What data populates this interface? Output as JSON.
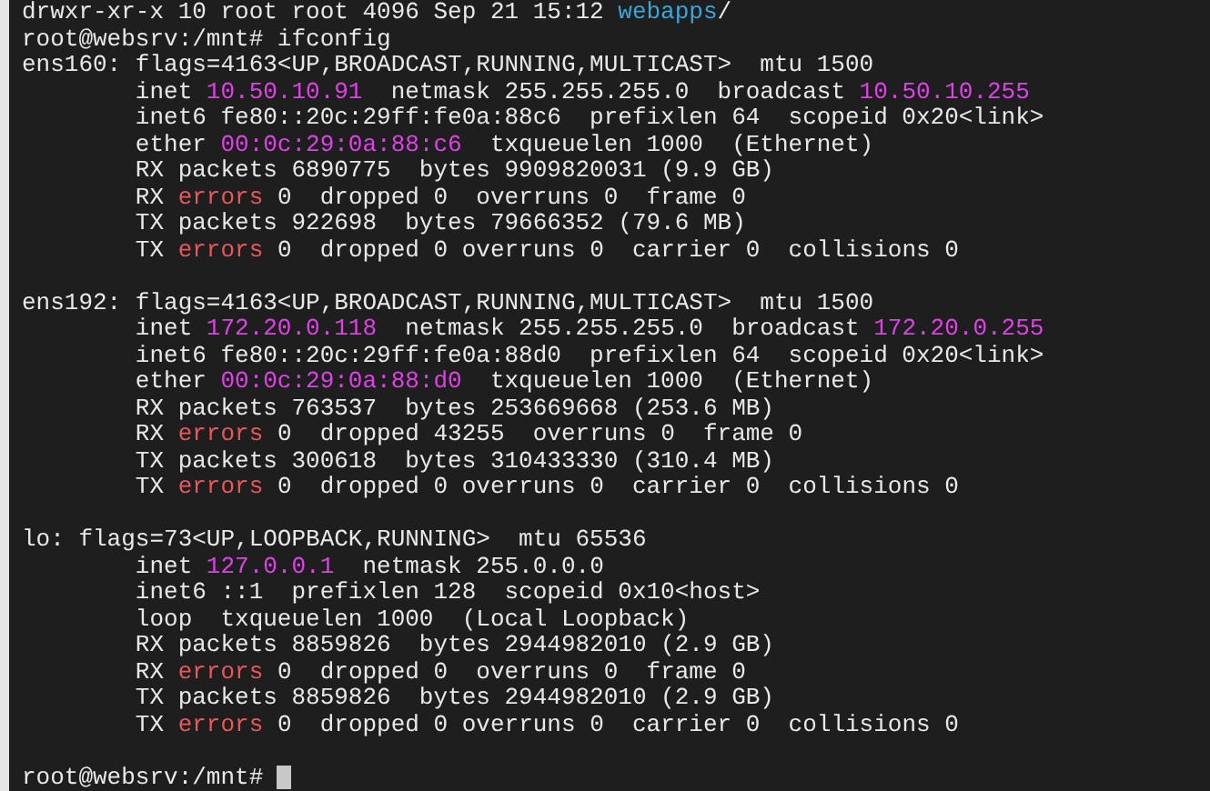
{
  "terminal": {
    "blocks": [
      {
        "lines": [
          {
            "segments": [
              {
                "text": "drwxr-xr-x 10 root root 4096 Sep 21 15:12 ",
                "kind": "plain"
              },
              {
                "text": "webapps",
                "kind": "dir"
              },
              {
                "text": "/",
                "kind": "plain"
              }
            ]
          },
          {
            "segments": [
              {
                "text": "root@websrv:/mnt# ifconfig",
                "kind": "plain"
              }
            ]
          },
          {
            "segments": [
              {
                "text": "ens160: flags=4163<UP,BROADCAST,RUNNING,MULTICAST>  mtu 1500",
                "kind": "plain"
              }
            ]
          },
          {
            "segments": [
              {
                "text": "        inet ",
                "kind": "plain"
              },
              {
                "text": "10.50.10.91",
                "kind": "address"
              },
              {
                "text": "  netmask 255.255.255.0  broadcast ",
                "kind": "plain"
              },
              {
                "text": "10.50.10.255",
                "kind": "address"
              }
            ]
          },
          {
            "segments": [
              {
                "text": "        inet6 fe80::20c:29ff:fe0a:88c6  prefixlen 64  scopeid 0x20<link>",
                "kind": "plain"
              }
            ]
          },
          {
            "segments": [
              {
                "text": "        ether ",
                "kind": "plain"
              },
              {
                "text": "00:0c:29:0a:88:c6",
                "kind": "address"
              },
              {
                "text": "  txqueuelen 1000  (Ethernet)",
                "kind": "plain"
              }
            ]
          },
          {
            "segments": [
              {
                "text": "        RX packets 6890775  bytes 9909820031 (9.9 GB)",
                "kind": "plain"
              }
            ]
          },
          {
            "segments": [
              {
                "text": "        RX ",
                "kind": "plain"
              },
              {
                "text": "errors",
                "kind": "error"
              },
              {
                "text": " 0  dropped 0  overruns 0  frame 0",
                "kind": "plain"
              }
            ]
          },
          {
            "segments": [
              {
                "text": "        TX packets 922698  bytes 79666352 (79.6 MB)",
                "kind": "plain"
              }
            ]
          },
          {
            "segments": [
              {
                "text": "        TX ",
                "kind": "plain"
              },
              {
                "text": "errors",
                "kind": "error"
              },
              {
                "text": " 0  dropped 0 overruns 0  carrier 0  collisions 0",
                "kind": "plain"
              }
            ]
          }
        ]
      },
      {
        "lines": [
          {
            "segments": [
              {
                "text": "ens192: flags=4163<UP,BROADCAST,RUNNING,MULTICAST>  mtu 1500",
                "kind": "plain"
              }
            ]
          },
          {
            "segments": [
              {
                "text": "        inet ",
                "kind": "plain"
              },
              {
                "text": "172.20.0.118",
                "kind": "address"
              },
              {
                "text": "  netmask 255.255.255.0  broadcast ",
                "kind": "plain"
              },
              {
                "text": "172.20.0.255",
                "kind": "address"
              }
            ]
          },
          {
            "segments": [
              {
                "text": "        inet6 fe80::20c:29ff:fe0a:88d0  prefixlen 64  scopeid 0x20<link>",
                "kind": "plain"
              }
            ]
          },
          {
            "segments": [
              {
                "text": "        ether ",
                "kind": "plain"
              },
              {
                "text": "00:0c:29:0a:88:d0",
                "kind": "address"
              },
              {
                "text": "  txqueuelen 1000  (Ethernet)",
                "kind": "plain"
              }
            ]
          },
          {
            "segments": [
              {
                "text": "        RX packets 763537  bytes 253669668 (253.6 MB)",
                "kind": "plain"
              }
            ]
          },
          {
            "segments": [
              {
                "text": "        RX ",
                "kind": "plain"
              },
              {
                "text": "errors",
                "kind": "error"
              },
              {
                "text": " 0  dropped 43255  overruns 0  frame 0",
                "kind": "plain"
              }
            ]
          },
          {
            "segments": [
              {
                "text": "        TX packets 300618  bytes 310433330 (310.4 MB)",
                "kind": "plain"
              }
            ]
          },
          {
            "segments": [
              {
                "text": "        TX ",
                "kind": "plain"
              },
              {
                "text": "errors",
                "kind": "error"
              },
              {
                "text": " 0  dropped 0 overruns 0  carrier 0  collisions 0",
                "kind": "plain"
              }
            ]
          }
        ]
      },
      {
        "lines": [
          {
            "segments": [
              {
                "text": "lo: flags=73<UP,LOOPBACK,RUNNING>  mtu 65536",
                "kind": "plain"
              }
            ]
          },
          {
            "segments": [
              {
                "text": "        inet ",
                "kind": "plain"
              },
              {
                "text": "127.0.0.1",
                "kind": "address"
              },
              {
                "text": "  netmask 255.0.0.0",
                "kind": "plain"
              }
            ]
          },
          {
            "segments": [
              {
                "text": "        inet6 ::1  prefixlen 128  scopeid 0x10<host>",
                "kind": "plain"
              }
            ]
          },
          {
            "segments": [
              {
                "text": "        loop  txqueuelen 1000  (Local Loopback)",
                "kind": "plain"
              }
            ]
          },
          {
            "segments": [
              {
                "text": "        RX packets 8859826  bytes 2944982010 (2.9 GB)",
                "kind": "plain"
              }
            ]
          },
          {
            "segments": [
              {
                "text": "        RX ",
                "kind": "plain"
              },
              {
                "text": "errors",
                "kind": "error"
              },
              {
                "text": " 0  dropped 0  overruns 0  frame 0",
                "kind": "plain"
              }
            ]
          },
          {
            "segments": [
              {
                "text": "        TX packets 8859826  bytes 2944982010 (2.9 GB)",
                "kind": "plain"
              }
            ]
          },
          {
            "segments": [
              {
                "text": "        TX ",
                "kind": "plain"
              },
              {
                "text": "errors",
                "kind": "error"
              },
              {
                "text": " 0  dropped 0 overruns 0  carrier 0  collisions 0",
                "kind": "plain"
              }
            ]
          }
        ]
      },
      {
        "lines": [
          {
            "segments": [
              {
                "text": "root@websrv:/mnt# ",
                "kind": "plain"
              }
            ],
            "cursor": true
          }
        ]
      }
    ]
  }
}
